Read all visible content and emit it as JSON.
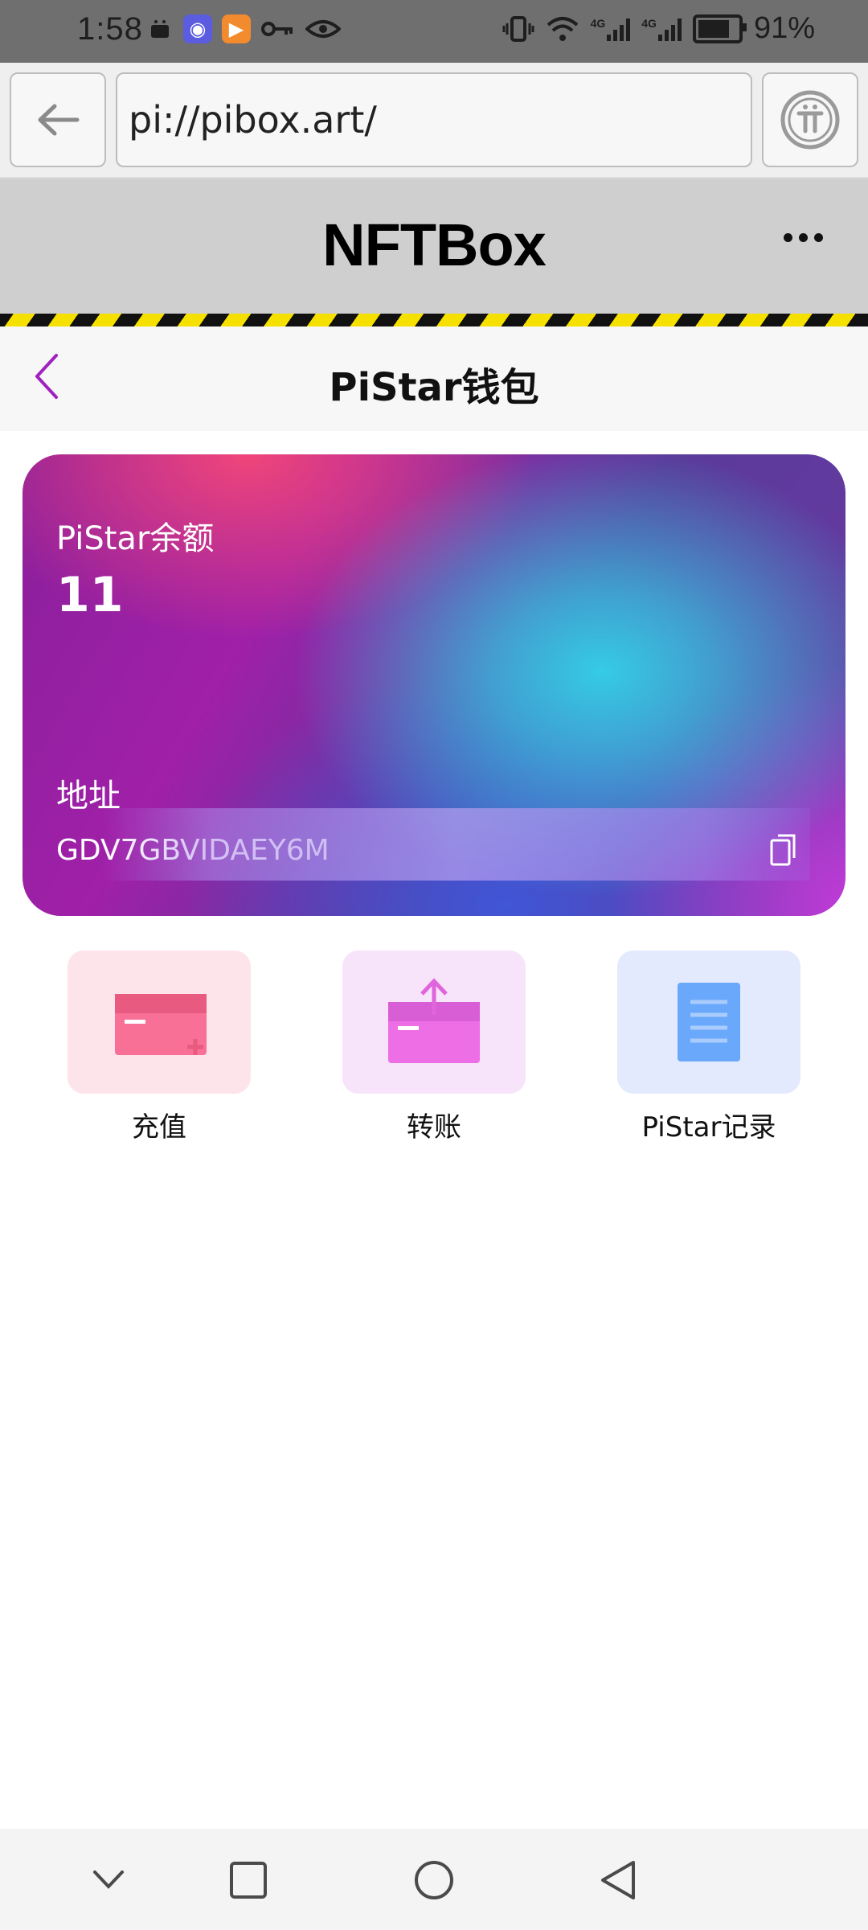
{
  "status_bar": {
    "time": "1:58",
    "battery_text": "91%",
    "battery_level": 0.91,
    "network_labels": [
      "4G",
      "4G"
    ],
    "icons": [
      "android-robot-icon",
      "eye-app-icon",
      "play-app-icon",
      "key-icon",
      "eye-icon",
      "vibrate-icon",
      "wifi-icon",
      "signal-icon",
      "signal-icon",
      "battery-icon"
    ]
  },
  "browser": {
    "url": "pi://pibox.art/",
    "back_icon": "arrow-left-icon",
    "pi_icon": "pi-logo-icon"
  },
  "app_header": {
    "title": "NFTBox",
    "more_icon": "more-dots-icon"
  },
  "page": {
    "title": "PiStar钱包",
    "back_icon": "chevron-left-icon"
  },
  "wallet_card": {
    "balance_label": "PiStar余额",
    "balance_value": "11",
    "address_label": "地址",
    "address_value": "GDV7GBVIDAEY6M",
    "copy_icon": "copy-icon"
  },
  "actions": [
    {
      "label": "充值",
      "icon": "recharge-card-icon",
      "color": "#fde4ea"
    },
    {
      "label": "转账",
      "icon": "transfer-card-icon",
      "color": "#f7e3fa"
    },
    {
      "label": "PiStar记录",
      "icon": "record-document-icon",
      "color": "#e3eafd"
    }
  ],
  "colors": {
    "accent": "#a020c0",
    "card_gradient": [
      "#f0457a",
      "#a020a8",
      "#35cbe6",
      "#4056d6",
      "#c03bd8"
    ]
  },
  "nav_bar": [
    "chevron-down-icon",
    "recents-square-icon",
    "home-circle-icon",
    "back-triangle-icon"
  ]
}
